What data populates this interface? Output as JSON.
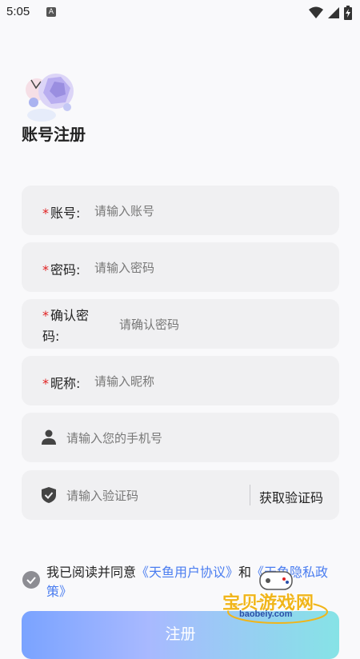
{
  "status_bar": {
    "time": "5:05",
    "notification_icon": "A"
  },
  "page_title": "账号注册",
  "fields": [
    {
      "label": "账号:",
      "placeholder": "请输入账号",
      "required": "*"
    },
    {
      "label": "密码:",
      "placeholder": "请输入密码",
      "required": "*"
    },
    {
      "label_line1": "确认密",
      "label_line2": "码:",
      "placeholder": "请确认密码",
      "required": "*"
    },
    {
      "label": "昵称:",
      "placeholder": "请输入昵称",
      "required": "*"
    },
    {
      "icon": "person-icon",
      "placeholder": "请输入您的手机号"
    },
    {
      "icon": "shield-check-icon",
      "placeholder": "请输入验证码",
      "action": "获取验证码"
    }
  ],
  "agreement": {
    "prefix": "我已阅读并同意",
    "user_agreement": "《天鱼用户协议》",
    "conjunction": "和",
    "privacy_policy": "《天鱼隐私政策》"
  },
  "register_button": "注册",
  "watermark": {
    "text": "宝贝游戏网",
    "url": "baobeiy.com"
  }
}
